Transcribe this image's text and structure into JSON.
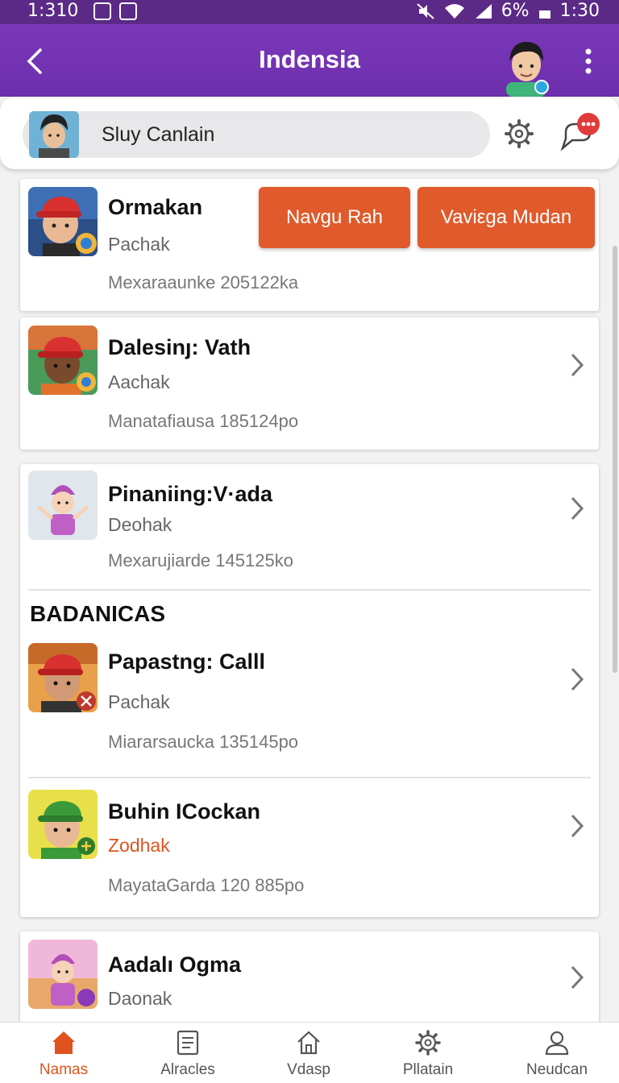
{
  "status_bar": {
    "time_left": "1:310",
    "battery": "6%",
    "time_right": "1:30"
  },
  "header": {
    "title": "Indensia"
  },
  "search": {
    "value": "Sluy Canlain"
  },
  "actions": {
    "primary": "Navgu Rah",
    "secondary": "Vaviεga Mudan"
  },
  "list": [
    {
      "name": "Ormakan",
      "sub": "Pachak",
      "meta": "Mexaraaunke 205122ka"
    },
    {
      "name": "Dalesinȷ: Vath",
      "sub": "Aachak",
      "meta": "Manatafiausa 185124po"
    },
    {
      "name": "Pinaniing:V·ada",
      "sub": "Deohak",
      "meta": "Mexarujiarde 145125ko"
    }
  ],
  "section_title": "BADANICAS",
  "section_list": [
    {
      "name": "Papastng: Calll",
      "sub": "Pachak",
      "meta": "Miararsaucka 135145po"
    },
    {
      "name": "Buhin ICockan",
      "sub": "Zodhak",
      "meta": "MayataGarda 120 885po"
    }
  ],
  "last_item": {
    "name": "Aadalı Ogma",
    "sub": "Daonak"
  },
  "nav": [
    {
      "label": "Namas",
      "icon": "home-icon",
      "active": true
    },
    {
      "label": "Alracles",
      "icon": "articles-icon",
      "active": false
    },
    {
      "label": "Vdasp",
      "icon": "house-outline-icon",
      "active": false
    },
    {
      "label": "Pllatain",
      "icon": "gear-icon",
      "active": false
    },
    {
      "label": "Neudcan",
      "icon": "person-icon",
      "active": false
    }
  ],
  "colors": {
    "header": "#6d2fad",
    "accent": "#e05a2b",
    "status_bar": "#5b2a86"
  }
}
